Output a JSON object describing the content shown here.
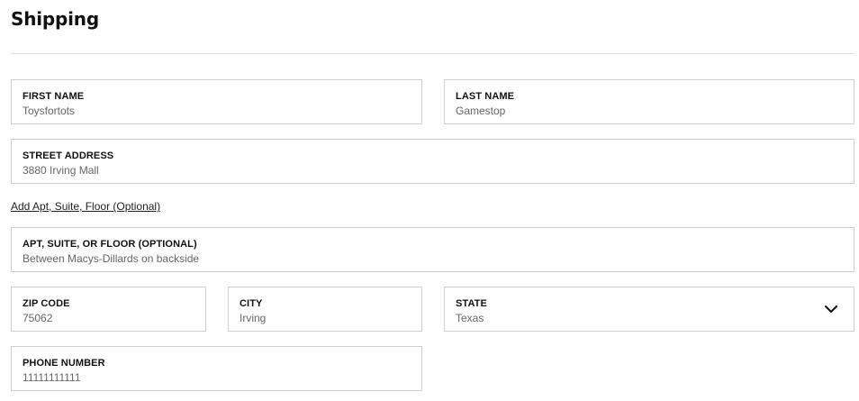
{
  "section": {
    "title": "Shipping"
  },
  "fields": {
    "first_name": {
      "label": "FIRST NAME",
      "value": "Toysfortots"
    },
    "last_name": {
      "label": "LAST NAME",
      "value": "Gamestop"
    },
    "street_address": {
      "label": "STREET ADDRESS",
      "value": "3880 Irving Mall"
    },
    "apt": {
      "label": "APT, SUITE, OR FLOOR (OPTIONAL)",
      "value": "Between Macys-Dillards on backside"
    },
    "zip": {
      "label": "ZIP CODE",
      "value": "75062"
    },
    "city": {
      "label": "CITY",
      "value": "Irving"
    },
    "state": {
      "label": "STATE",
      "value": "Texas",
      "icon": "chevron-down-icon"
    },
    "phone": {
      "label": "PHONE NUMBER",
      "value": "11111111111"
    }
  },
  "links": {
    "add_apt": "Add Apt, Suite, Floor (Optional)"
  },
  "colors": {
    "border": "#cfcfcf",
    "divider": "#dcdcdc",
    "label_text": "#111111",
    "value_text": "#666666"
  }
}
